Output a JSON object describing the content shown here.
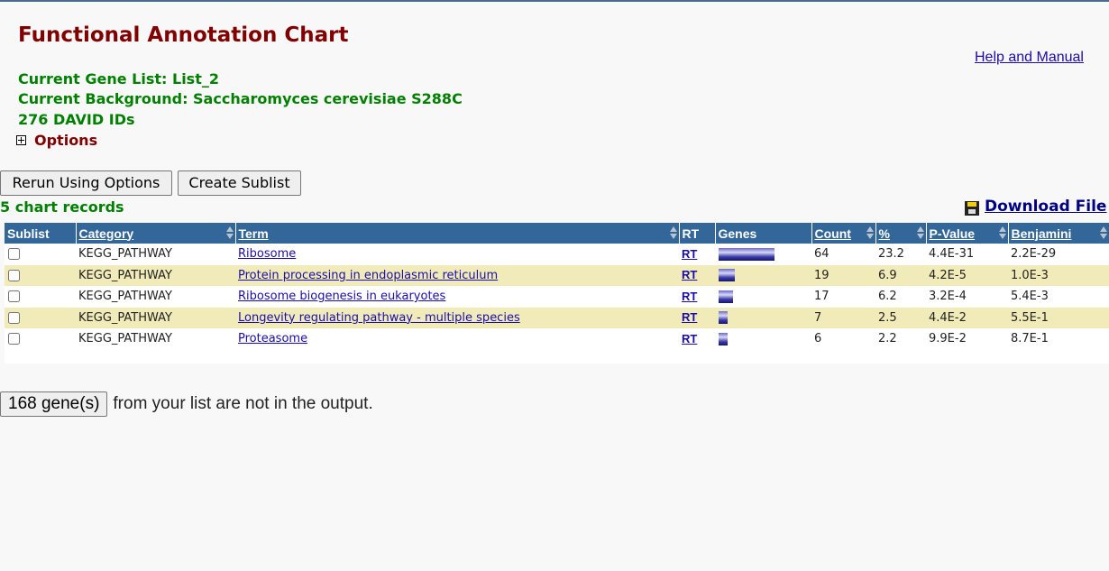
{
  "header": {
    "title": "Functional Annotation Chart",
    "help_link": "Help and Manual",
    "gene_list": "Current Gene List: List_2",
    "background": "Current Background: Saccharomyces cerevisiae S288C",
    "ids": "276 DAVID IDs",
    "options_label": "Options"
  },
  "actions": {
    "rerun": "Rerun Using Options",
    "sublist": "Create Sublist",
    "records": "5 chart records",
    "download": "Download File"
  },
  "table": {
    "columns": [
      "Sublist",
      "Category",
      "Term",
      "RT",
      "Genes",
      "Count",
      "%",
      "P-Value",
      "Benjamini"
    ],
    "gene_bar_max_count": 64,
    "rows": [
      {
        "category": "KEGG_PATHWAY",
        "term": "Ribosome",
        "rt": "RT",
        "count": "64",
        "percent": "23.2",
        "pvalue": "4.4E-31",
        "benjamini": "2.2E-29",
        "bar_fraction": 1.0
      },
      {
        "category": "KEGG_PATHWAY",
        "term": "Protein processing in endoplasmic reticulum",
        "rt": "RT",
        "count": "19",
        "percent": "6.9",
        "pvalue": "4.2E-5",
        "benjamini": "1.0E-3",
        "bar_fraction": 0.297
      },
      {
        "category": "KEGG_PATHWAY",
        "term": "Ribosome biogenesis in eukaryotes",
        "rt": "RT",
        "count": "17",
        "percent": "6.2",
        "pvalue": "3.2E-4",
        "benjamini": "5.4E-3",
        "bar_fraction": 0.266
      },
      {
        "category": "KEGG_PATHWAY",
        "term": "Longevity regulating pathway - multiple species",
        "rt": "RT",
        "count": "7",
        "percent": "2.5",
        "pvalue": "4.4E-2",
        "benjamini": "5.5E-1",
        "bar_fraction": 0.109
      },
      {
        "category": "KEGG_PATHWAY",
        "term": "Proteasome",
        "rt": "RT",
        "count": "6",
        "percent": "2.2",
        "pvalue": "9.9E-2",
        "benjamini": "8.7E-1",
        "bar_fraction": 0.094
      }
    ]
  },
  "footer": {
    "genes_button": "168 gene(s)",
    "text": "from your list are not in the output."
  }
}
